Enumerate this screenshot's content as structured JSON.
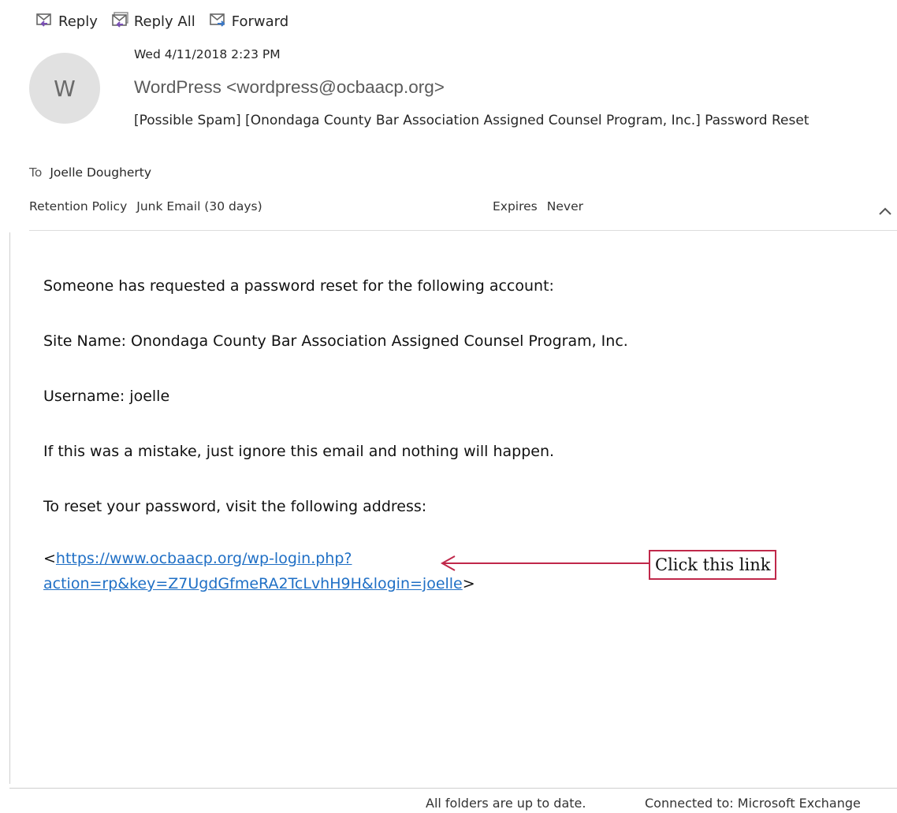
{
  "toolbar": {
    "reply": {
      "label": "Reply",
      "icon": "reply-icon"
    },
    "reply_all": {
      "label": "Reply All",
      "icon": "reply-all-icon"
    },
    "forward": {
      "label": "Forward",
      "icon": "forward-icon"
    }
  },
  "message": {
    "avatar_initial": "W",
    "date": "Wed 4/11/2018 2:23 PM",
    "sender": "WordPress <wordpress@ocbaacp.org>",
    "subject": "[Possible Spam] [Onondaga County Bar Association Assigned Counsel Program, Inc.] Password Reset",
    "to_label": "To",
    "to_value": "Joelle Dougherty",
    "retention_label": "Retention Policy",
    "retention_value": "Junk Email (30 days)",
    "expires_label": "Expires",
    "expires_value": "Never"
  },
  "body": {
    "line1": "Someone has requested a password reset for the following account:",
    "line2": "Site Name: Onondaga County Bar Association Assigned Counsel Program, Inc.",
    "line3": "Username: joelle",
    "line4": "If this was a mistake, just ignore this email and nothing will happen.",
    "line5": "To reset your password, visit the following address:",
    "link_open": "<",
    "link_line1": "https://www.ocbaacp.org/wp-login.php?",
    "link_line2": "action=rp&key=Z7UgdGfmeRA2TcLvhH9H&login=joelle",
    "link_close": ">"
  },
  "annotation": {
    "text": "Click this link",
    "color": "#c0284a"
  },
  "status": {
    "folders": "All folders are up to date.",
    "connection": "Connected to: Microsoft Exchange"
  },
  "colors": {
    "link": "#1f6fc5",
    "accent": "#7a4fb5"
  }
}
